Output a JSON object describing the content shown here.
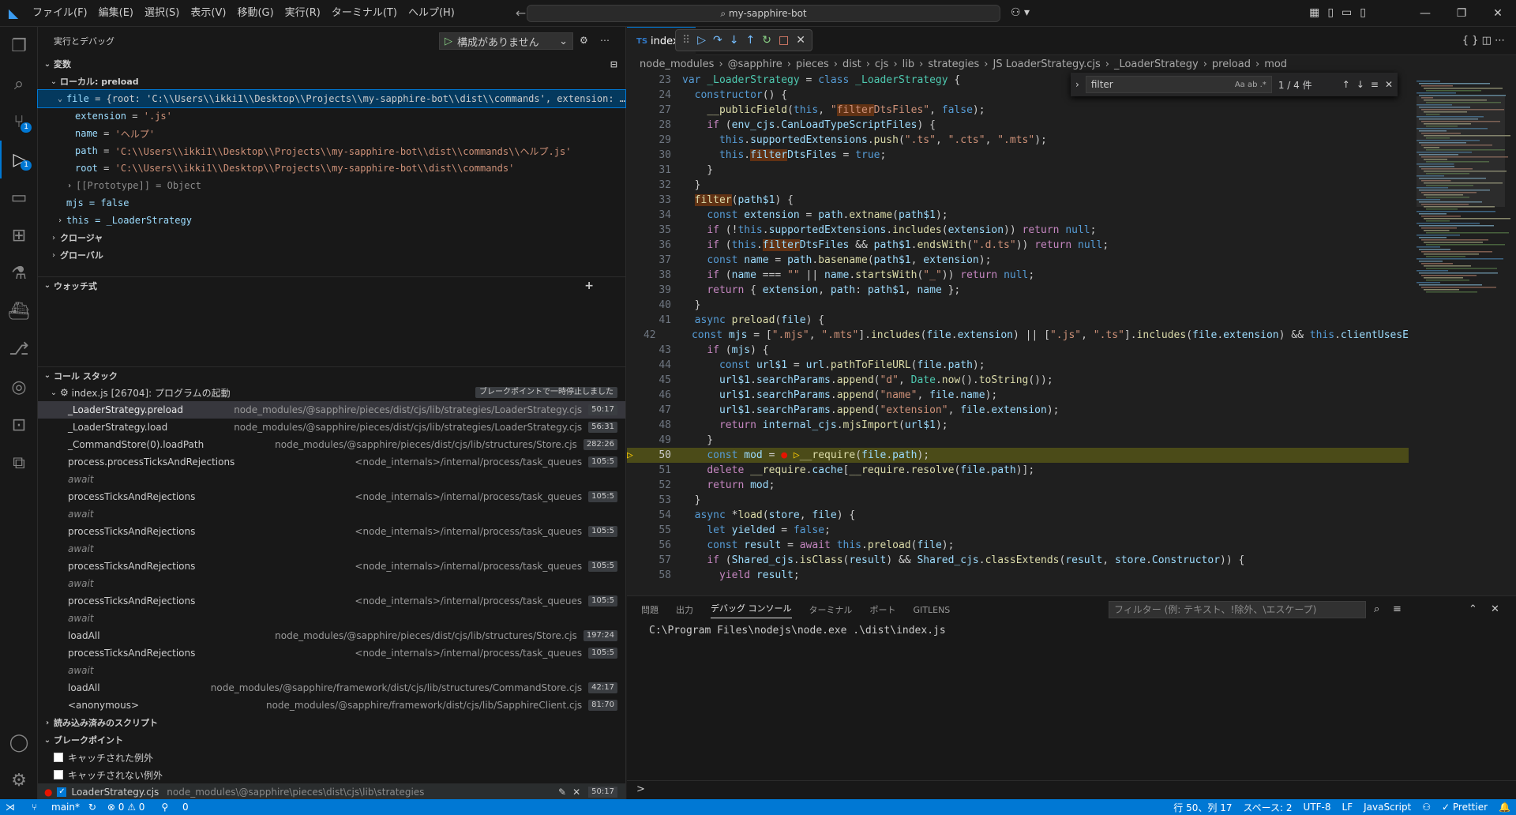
{
  "menu": [
    "ファイル(F)",
    "編集(E)",
    "選択(S)",
    "表示(V)",
    "移動(G)",
    "実行(R)",
    "ターミナル(T)",
    "ヘルプ(H)"
  ],
  "search": {
    "label": "my-sapphire-bot"
  },
  "sidebar": {
    "title": "実行とデバッグ",
    "run_config": "構成がありません",
    "variables_title": "変数",
    "local_scope": "ローカル: preload",
    "file_row": "{root: 'C:\\\\Users\\\\ikki1\\\\Desktop\\\\Projects\\\\my-sapphire-bot\\\\dist\\\\commands', extension: …",
    "vars": [
      {
        "name": "extension",
        "value": "'.js'"
      },
      {
        "name": "name",
        "value": "'ヘルプ'"
      },
      {
        "name": "path",
        "value": "'C:\\\\Users\\\\ikki1\\\\Desktop\\\\Projects\\\\my-sapphire-bot\\\\dist\\\\commands\\\\ヘルプ.js'"
      },
      {
        "name": "root",
        "value": "'C:\\\\Users\\\\ikki1\\\\Desktop\\\\Projects\\\\my-sapphire-bot\\\\dist\\\\commands'"
      }
    ],
    "prototype": "[[Prototype]] = Object",
    "mjs": "mjs = false",
    "this_row": "this = _LoaderStrategy",
    "closure": "クロージャ",
    "global": "グローバル",
    "watch_title": "ウォッチ式",
    "callstack_title": "コール スタック",
    "thread": "index.js [26704]: プログラムの起動",
    "paused_badge": "ブレークポイントで一時停止しました",
    "frames": [
      {
        "fn": "_LoaderStrategy.preload",
        "path": "node_modules/@sapphire/pieces/dist/cjs/lib/strategies/LoaderStrategy.cjs",
        "ln": "50:17",
        "await": false
      },
      {
        "fn": "_LoaderStrategy.load",
        "path": "node_modules/@sapphire/pieces/dist/cjs/lib/strategies/LoaderStrategy.cjs",
        "ln": "56:31",
        "await": false
      },
      {
        "fn": "_CommandStore(0).loadPath",
        "path": "node_modules/@sapphire/pieces/dist/cjs/lib/structures/Store.cjs",
        "ln": "282:26",
        "await": false
      },
      {
        "fn": "process.processTicksAndRejections",
        "path": "<node_internals>/internal/process/task_queues",
        "ln": "105:5",
        "await": true
      },
      {
        "fn": "processTicksAndRejections",
        "path": "<node_internals>/internal/process/task_queues",
        "ln": "105:5",
        "await": true
      },
      {
        "fn": "processTicksAndRejections",
        "path": "<node_internals>/internal/process/task_queues",
        "ln": "105:5",
        "await": true
      },
      {
        "fn": "processTicksAndRejections",
        "path": "<node_internals>/internal/process/task_queues",
        "ln": "105:5",
        "await": true
      },
      {
        "fn": "processTicksAndRejections",
        "path": "<node_internals>/internal/process/task_queues",
        "ln": "105:5",
        "await": true
      },
      {
        "fn": "loadAll",
        "path": "node_modules/@sapphire/pieces/dist/cjs/lib/structures/Store.cjs",
        "ln": "197:24",
        "await": false
      },
      {
        "fn": "processTicksAndRejections",
        "path": "<node_internals>/internal/process/task_queues",
        "ln": "105:5",
        "await": true
      },
      {
        "fn": "loadAll",
        "path": "node_modules/@sapphire/framework/dist/cjs/lib/structures/CommandStore.cjs",
        "ln": "42:17",
        "await": false
      },
      {
        "fn": "<anonymous>",
        "path": "node_modules/@sapphire/framework/dist/cjs/lib/SapphireClient.cjs",
        "ln": "81:70",
        "await": false
      }
    ],
    "await_label": "await",
    "loaded_scripts": "読み込み済みのスクリプト",
    "breakpoints_title": "ブレークポイント",
    "bp_caught": "キャッチされた例外",
    "bp_uncaught": "キャッチされない例外",
    "bp_file": "LoaderStrategy.cjs",
    "bp_path": "node_modules\\@sapphire\\pieces\\dist\\cjs\\lib\\strategies",
    "bp_ln": "50:17"
  },
  "editor": {
    "tab": "index.t",
    "tab_lang": "TS",
    "breadcrumbs": [
      "node_modules",
      "@sapphire",
      "pieces",
      "dist",
      "cjs",
      "lib",
      "strategies",
      "JS LoaderStrategy.cjs",
      "_LoaderStrategy",
      "preload",
      "mod"
    ],
    "find_query": "filter",
    "find_count": "1 / 4 件",
    "find_opts": "Aa  ab  .*"
  },
  "panel": {
    "tabs": [
      "問題",
      "出力",
      "デバッグ コンソール",
      "ターミナル",
      "ポート",
      "GITLENS"
    ],
    "filter_placeholder": "フィルター (例: テキスト、!除外、\\エスケープ)",
    "console_line": "C:\\Program Files\\nodejs\\node.exe .\\dist\\index.js",
    "prompt": ">"
  },
  "status": {
    "branch": "main*",
    "errors": "⊗ 0 ⚠ 0",
    "ports": "0",
    "position": "行 50、列 17",
    "spaces": "スペース: 2",
    "encoding": "UTF-8",
    "eol": "LF",
    "language": "JavaScript",
    "prettier": "✓ Prettier"
  }
}
